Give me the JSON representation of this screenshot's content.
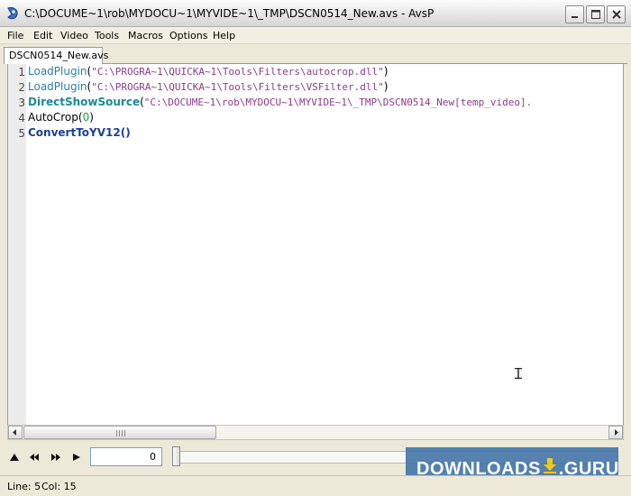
{
  "window": {
    "title": "C:\\DOCUME~1\\rob\\MYDOCU~1\\MYVIDE~1\\_TMP\\DSCN0514_New.avs - AvsP"
  },
  "menu": {
    "items": [
      "File",
      "Edit",
      "Video",
      "Tools",
      "Macros",
      "Options",
      "Help"
    ]
  },
  "tabs": [
    {
      "label": "DSCN0514_New.avs"
    }
  ],
  "editor": {
    "lines": [
      {
        "number": "1",
        "func": "LoadPlugin",
        "open": "(",
        "arg": "\"C:\\PROGRA~1\\QUICKA~1\\Tools\\Filters\\autocrop.dll\"",
        "close": ")"
      },
      {
        "number": "2",
        "func": "LoadPlugin",
        "open": "(",
        "arg": "\"C:\\PROGRA~1\\QUICKA~1\\Tools\\Filters\\VSFilter.dll\"",
        "close": ")"
      },
      {
        "number": "3",
        "func": "DirectShowSource",
        "open": "(",
        "arg": "\"C:\\DOCUME~1\\rob\\MYDOCU~1\\MYVIDE~1\\_TMP\\DSCN0514_New[temp_video].",
        "close": ""
      },
      {
        "number": "4",
        "func": "AutoCrop",
        "open": "(",
        "arg": "0",
        "close": ")"
      },
      {
        "number": "5",
        "func": "ConvertToYV12",
        "open": "()",
        "arg": "",
        "close": ""
      }
    ]
  },
  "controls": {
    "frame_value": "0",
    "slider_position": 0
  },
  "watermark": {
    "text_left": "DOWNLOADS",
    "text_right": ".GURU"
  },
  "status": {
    "line": "Line: 5",
    "col": "Col: 15"
  },
  "colors": {
    "function": "#2a7fa8",
    "string": "#8a3b8a",
    "number": "#1d9b3a",
    "watermark_bg": "#3f73a8"
  }
}
